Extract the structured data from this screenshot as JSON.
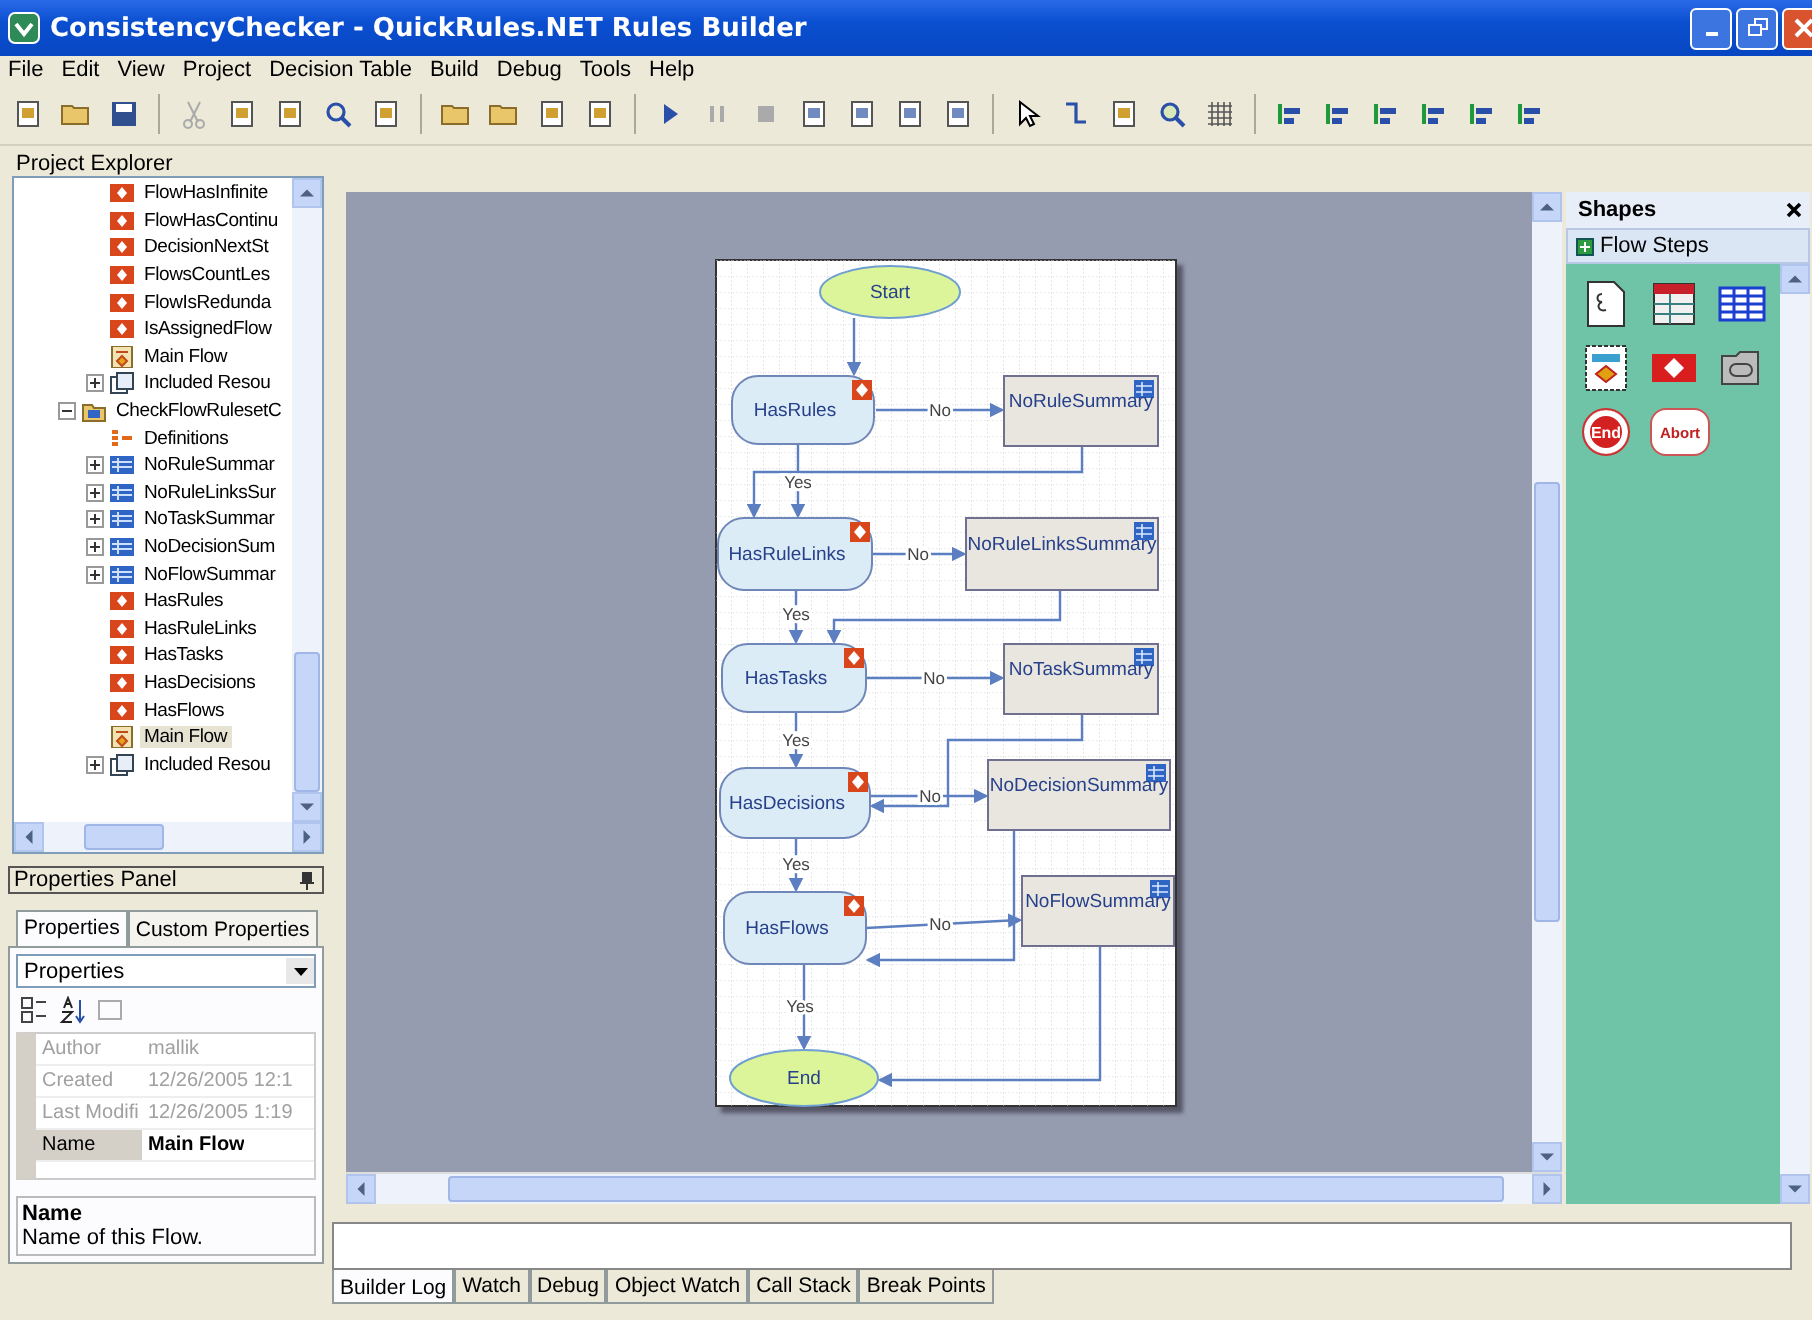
{
  "window": {
    "title": "ConsistencyChecker - QuickRules.NET Rules Builder"
  },
  "menu": [
    "File",
    "Edit",
    "View",
    "Project",
    "Decision Table",
    "Build",
    "Debug",
    "Tools",
    "Help"
  ],
  "project_explorer": {
    "title": "Project Explorer",
    "continued_items": [
      {
        "label": "FlowHasInfinite",
        "kind": "rule",
        "selected": false
      },
      {
        "label": "FlowHasContinu",
        "kind": "rule",
        "selected": false
      },
      {
        "label": "DecisionNextSt",
        "kind": "rule",
        "selected": false
      },
      {
        "label": "FlowsCountLes",
        "kind": "rule",
        "selected": false
      },
      {
        "label": "FlowIsRedunda",
        "kind": "rule",
        "selected": false
      },
      {
        "label": "IsAssignedFlow",
        "kind": "rule",
        "selected": false
      },
      {
        "label": "Main Flow",
        "kind": "flow",
        "selected": false
      },
      {
        "label": "Included Resou",
        "kind": "resources",
        "expanded": false,
        "selected": false
      }
    ],
    "items": [
      {
        "label": "CheckFlowRulesetC",
        "kind": "ruleset",
        "expanded": true,
        "selected": false,
        "children": [
          {
            "label": "Definitions",
            "kind": "definitions",
            "selected": false
          },
          {
            "label": "NoRuleSummar",
            "kind": "table",
            "expanded": false,
            "selected": false
          },
          {
            "label": "NoRuleLinksSur",
            "kind": "table",
            "expanded": false,
            "selected": false
          },
          {
            "label": "NoTaskSummar",
            "kind": "table",
            "expanded": false,
            "selected": false
          },
          {
            "label": "NoDecisionSum",
            "kind": "table",
            "expanded": false,
            "selected": false
          },
          {
            "label": "NoFlowSummar",
            "kind": "table",
            "expanded": false,
            "selected": false
          },
          {
            "label": "HasRules",
            "kind": "rule",
            "selected": false
          },
          {
            "label": "HasRuleLinks",
            "kind": "rule",
            "selected": false
          },
          {
            "label": "HasTasks",
            "kind": "rule",
            "selected": false
          },
          {
            "label": "HasDecisions",
            "kind": "rule",
            "selected": false
          },
          {
            "label": "HasFlows",
            "kind": "rule",
            "selected": false
          },
          {
            "label": "Main Flow",
            "kind": "flow",
            "selected": true
          },
          {
            "label": "Included Resou",
            "kind": "resources",
            "expanded": false,
            "selected": false
          }
        ]
      }
    ]
  },
  "properties_panel": {
    "title": "Properties Panel",
    "tabs": [
      {
        "label": "Properties",
        "selected": true
      },
      {
        "label": "Custom Properties",
        "selected": false
      }
    ],
    "dropdown": {
      "value": "Properties"
    },
    "rows": [
      {
        "name": "Author",
        "value": "mallik",
        "disabled": true
      },
      {
        "name": "Created",
        "value": "12/26/2005 12:1",
        "disabled": true
      },
      {
        "name": "Last Modifi",
        "value": "12/26/2005 1:19",
        "disabled": true
      },
      {
        "name": "Name",
        "value": "Main Flow",
        "disabled": false
      }
    ],
    "description": {
      "title": "Name",
      "text": "Name of this Flow."
    }
  },
  "flow": {
    "nodes": [
      {
        "kind": "start",
        "label": "Start"
      },
      {
        "kind": "rule",
        "label": "HasRules"
      },
      {
        "kind": "table",
        "label": "NoRuleSummary"
      },
      {
        "kind": "rule",
        "label": "HasRuleLinks"
      },
      {
        "kind": "table",
        "label": "NoRuleLinksSummary"
      },
      {
        "kind": "rule",
        "label": "HasTasks"
      },
      {
        "kind": "table",
        "label": "NoTaskSummary"
      },
      {
        "kind": "rule",
        "label": "HasDecisions"
      },
      {
        "kind": "table",
        "label": "NoDecisionSummary"
      },
      {
        "kind": "rule",
        "label": "HasFlows"
      },
      {
        "kind": "table",
        "label": "NoFlowSummary"
      },
      {
        "kind": "end",
        "label": "End"
      }
    ],
    "connectors": [
      {
        "label": "No"
      },
      {
        "label": "Yes"
      },
      {
        "label": "No"
      },
      {
        "label": "Yes"
      },
      {
        "label": "No"
      },
      {
        "label": "Yes"
      },
      {
        "label": "No"
      },
      {
        "label": "Yes"
      },
      {
        "label": "No"
      },
      {
        "label": "Yes"
      }
    ]
  },
  "shapes_panel": {
    "title": "Shapes",
    "section": "Flow Steps",
    "shapes": [
      {
        "kind": "document"
      },
      {
        "kind": "table"
      },
      {
        "kind": "grid"
      },
      {
        "kind": "flowchart"
      },
      {
        "kind": "rule"
      },
      {
        "kind": "folder"
      },
      {
        "kind": "end",
        "label": "End"
      },
      {
        "kind": "abort",
        "label": "Abort"
      }
    ]
  },
  "bottom_tabs": [
    {
      "label": "Builder Log",
      "selected": true
    },
    {
      "label": "Watch",
      "selected": false
    },
    {
      "label": "Debug",
      "selected": false
    },
    {
      "label": "Object Watch",
      "selected": false
    },
    {
      "label": "Call Stack",
      "selected": false
    },
    {
      "label": "Break Points",
      "selected": false
    }
  ]
}
